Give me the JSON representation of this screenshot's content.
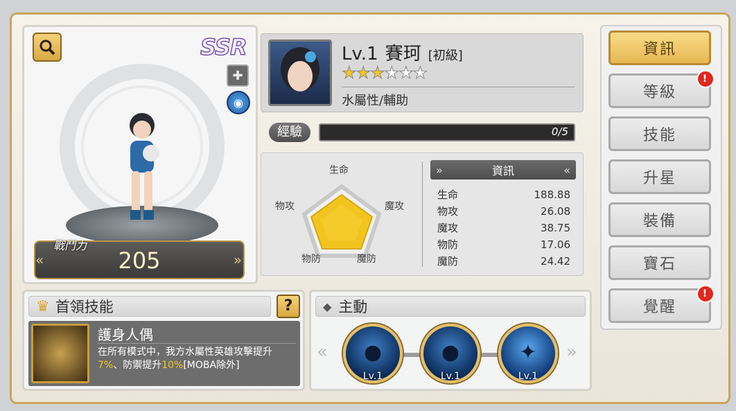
{
  "hero": {
    "rarity": "SSR",
    "level_label": "Lv.1",
    "name": "賽珂",
    "grade": "[初級]",
    "stars_total": 6,
    "stars_filled": 3,
    "attribute": "水屬性/輔助",
    "power_label": "戰鬥力",
    "power_value": "205"
  },
  "exp": {
    "label": "經驗",
    "value": "0/5",
    "progress": 0
  },
  "radar": {
    "labels": {
      "top": "生命",
      "left": "物攻",
      "right": "魔攻",
      "bottom_left": "物防",
      "bottom_right": "魔防"
    }
  },
  "stats": {
    "title": "資訊",
    "rows": [
      {
        "name": "生命",
        "value": "188.88"
      },
      {
        "name": "物攻",
        "value": "26.08"
      },
      {
        "name": "魔攻",
        "value": "38.75"
      },
      {
        "name": "物防",
        "value": "17.06"
      },
      {
        "name": "魔防",
        "value": "24.42"
      }
    ]
  },
  "leader_skill": {
    "header": "首領技能",
    "help": "?",
    "name": "護身人偶",
    "desc_1": "在所有模式中，我方水屬性英雄攻擊提升",
    "pct_1": "7%",
    "desc_2": "、防禦提升",
    "pct_2": "10%",
    "desc_3": "[MOBA除外]"
  },
  "active_skill": {
    "header": "主動",
    "levels": [
      "Lv.1",
      "Lv.1",
      "Lv.1"
    ]
  },
  "menu": {
    "items": [
      {
        "label": "資訊",
        "active": true,
        "alert": false
      },
      {
        "label": "等級",
        "active": false,
        "alert": true
      },
      {
        "label": "技能",
        "active": false,
        "alert": false
      },
      {
        "label": "升星",
        "active": false,
        "alert": false
      },
      {
        "label": "裝備",
        "active": false,
        "alert": false
      },
      {
        "label": "寶石",
        "active": false,
        "alert": false
      },
      {
        "label": "覺醒",
        "active": false,
        "alert": true
      }
    ],
    "alert_mark": "!"
  },
  "colors": {
    "gold": "#e7b752",
    "highlight": "#f3c622",
    "panel": "#f3f4f4"
  }
}
